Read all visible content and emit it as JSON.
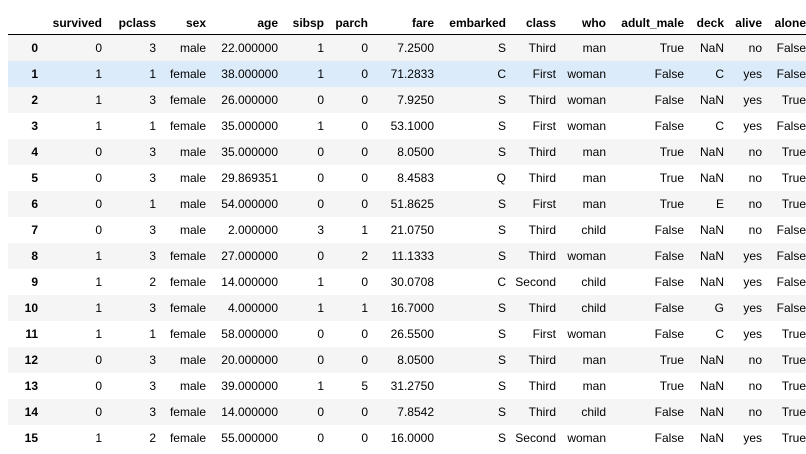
{
  "table": {
    "columns": [
      "",
      "survived",
      "pclass",
      "sex",
      "age",
      "sibsp",
      "parch",
      "fare",
      "embarked",
      "class",
      "who",
      "adult_male",
      "deck",
      "alive",
      "alone"
    ],
    "highlighted_row": 1,
    "rows": [
      [
        "0",
        "0",
        "3",
        "male",
        "22.000000",
        "1",
        "0",
        "7.2500",
        "S",
        "Third",
        "man",
        "True",
        "NaN",
        "no",
        "False"
      ],
      [
        "1",
        "1",
        "1",
        "female",
        "38.000000",
        "1",
        "0",
        "71.2833",
        "C",
        "First",
        "woman",
        "False",
        "C",
        "yes",
        "False"
      ],
      [
        "2",
        "1",
        "3",
        "female",
        "26.000000",
        "0",
        "0",
        "7.9250",
        "S",
        "Third",
        "woman",
        "False",
        "NaN",
        "yes",
        "True"
      ],
      [
        "3",
        "1",
        "1",
        "female",
        "35.000000",
        "1",
        "0",
        "53.1000",
        "S",
        "First",
        "woman",
        "False",
        "C",
        "yes",
        "False"
      ],
      [
        "4",
        "0",
        "3",
        "male",
        "35.000000",
        "0",
        "0",
        "8.0500",
        "S",
        "Third",
        "man",
        "True",
        "NaN",
        "no",
        "True"
      ],
      [
        "5",
        "0",
        "3",
        "male",
        "29.869351",
        "0",
        "0",
        "8.4583",
        "Q",
        "Third",
        "man",
        "True",
        "NaN",
        "no",
        "True"
      ],
      [
        "6",
        "0",
        "1",
        "male",
        "54.000000",
        "0",
        "0",
        "51.8625",
        "S",
        "First",
        "man",
        "True",
        "E",
        "no",
        "True"
      ],
      [
        "7",
        "0",
        "3",
        "male",
        "2.000000",
        "3",
        "1",
        "21.0750",
        "S",
        "Third",
        "child",
        "False",
        "NaN",
        "no",
        "False"
      ],
      [
        "8",
        "1",
        "3",
        "female",
        "27.000000",
        "0",
        "2",
        "11.1333",
        "S",
        "Third",
        "woman",
        "False",
        "NaN",
        "yes",
        "False"
      ],
      [
        "9",
        "1",
        "2",
        "female",
        "14.000000",
        "1",
        "0",
        "30.0708",
        "C",
        "Second",
        "child",
        "False",
        "NaN",
        "yes",
        "False"
      ],
      [
        "10",
        "1",
        "3",
        "female",
        "4.000000",
        "1",
        "1",
        "16.7000",
        "S",
        "Third",
        "child",
        "False",
        "G",
        "yes",
        "False"
      ],
      [
        "11",
        "1",
        "1",
        "female",
        "58.000000",
        "0",
        "0",
        "26.5500",
        "S",
        "First",
        "woman",
        "False",
        "C",
        "yes",
        "True"
      ],
      [
        "12",
        "0",
        "3",
        "male",
        "20.000000",
        "0",
        "0",
        "8.0500",
        "S",
        "Third",
        "man",
        "True",
        "NaN",
        "no",
        "True"
      ],
      [
        "13",
        "0",
        "3",
        "male",
        "39.000000",
        "1",
        "5",
        "31.2750",
        "S",
        "Third",
        "man",
        "True",
        "NaN",
        "no",
        "True"
      ],
      [
        "14",
        "0",
        "3",
        "female",
        "14.000000",
        "0",
        "0",
        "7.8542",
        "S",
        "Third",
        "child",
        "False",
        "NaN",
        "no",
        "True"
      ],
      [
        "15",
        "1",
        "2",
        "female",
        "55.000000",
        "0",
        "0",
        "16.0000",
        "S",
        "Second",
        "woman",
        "False",
        "NaN",
        "yes",
        "True"
      ]
    ]
  }
}
